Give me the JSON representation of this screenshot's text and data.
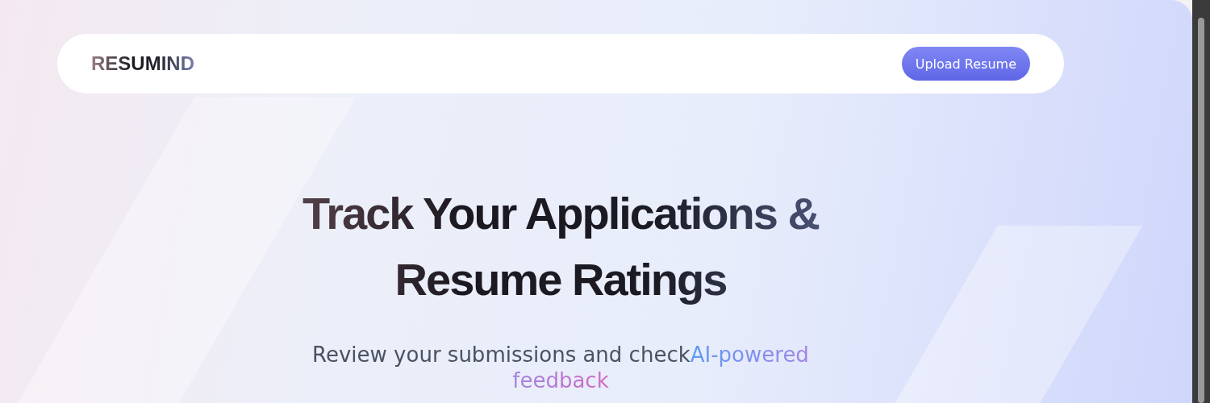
{
  "navbar": {
    "logo": "RESUMIND",
    "button": "Upload Resume"
  },
  "hero": {
    "title": "Track Your Applications & Resume Ratings",
    "subtitle": "Review your submissions and check",
    "highlight": "AI-powered feedback"
  }
}
